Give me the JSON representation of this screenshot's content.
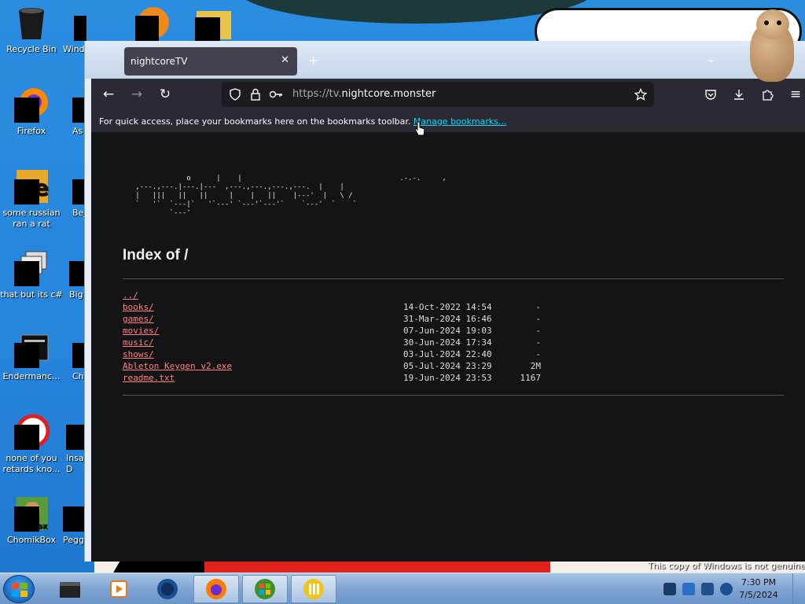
{
  "desktop": {
    "icons": [
      {
        "label": "Recycle Bin"
      },
      {
        "label": "Firefox"
      },
      {
        "label": "some russian ran a rat"
      },
      {
        "label": "that but its c#"
      },
      {
        "label": "Endermanc..."
      },
      {
        "label": "none of you retards kno..."
      },
      {
        "label": "ChomikBox"
      }
    ],
    "col2_labels": [
      "Wind",
      "As D",
      "Bej D",
      "Big D",
      "Ch D",
      "Insa D",
      "Pegg"
    ],
    "watermark": "This copy of Windows is not genuine"
  },
  "browser": {
    "tab_title": "nightcoreTV",
    "url_scheme": "https://tv.",
    "url_host": "nightcore.monster",
    "bookmark_hint": "For quick access, place your bookmarks here on the bookmarks toolbar.",
    "bookmark_link": "Manage bookmarks...",
    "page": {
      "ascii_logo": "               o      |    |                                     .-.-.     ,\n   ,---.,---.|---.|---  ,---.,---.,---.,---.  |    |\n   |   |||   ||   ||     |    |   ||    |---'  |   \\ /\n   `   '`  `---|`   '`---' `---'`---'`    `---'  `    `\n           `---'",
      "heading": "Index of /",
      "entries": [
        {
          "name": "../",
          "date": "",
          "size": ""
        },
        {
          "name": "books/",
          "date": "14-Oct-2022 14:54",
          "size": "-"
        },
        {
          "name": "games/",
          "date": "31-Mar-2024 16:46",
          "size": "-"
        },
        {
          "name": "movies/",
          "date": "07-Jun-2024 19:03",
          "size": "-"
        },
        {
          "name": "music/",
          "date": "30-Jun-2024 17:34",
          "size": "-"
        },
        {
          "name": "shows/",
          "date": "03-Jul-2024 22:40",
          "size": "-"
        },
        {
          "name": "Ableton Keygen v2.exe",
          "date": "05-Jul-2024 23:29",
          "size": "2M"
        },
        {
          "name": "readme.txt",
          "date": "19-Jun-2024 23:53",
          "size": "1167"
        }
      ]
    }
  },
  "taskbar": {
    "time": "7:30 PM",
    "date": "7/5/2024"
  },
  "colors": {
    "link": "#ff7f7f",
    "page_bg": "#141416",
    "toolbar_bg": "#2b2a33",
    "bookmark_link": "#00ddff"
  }
}
